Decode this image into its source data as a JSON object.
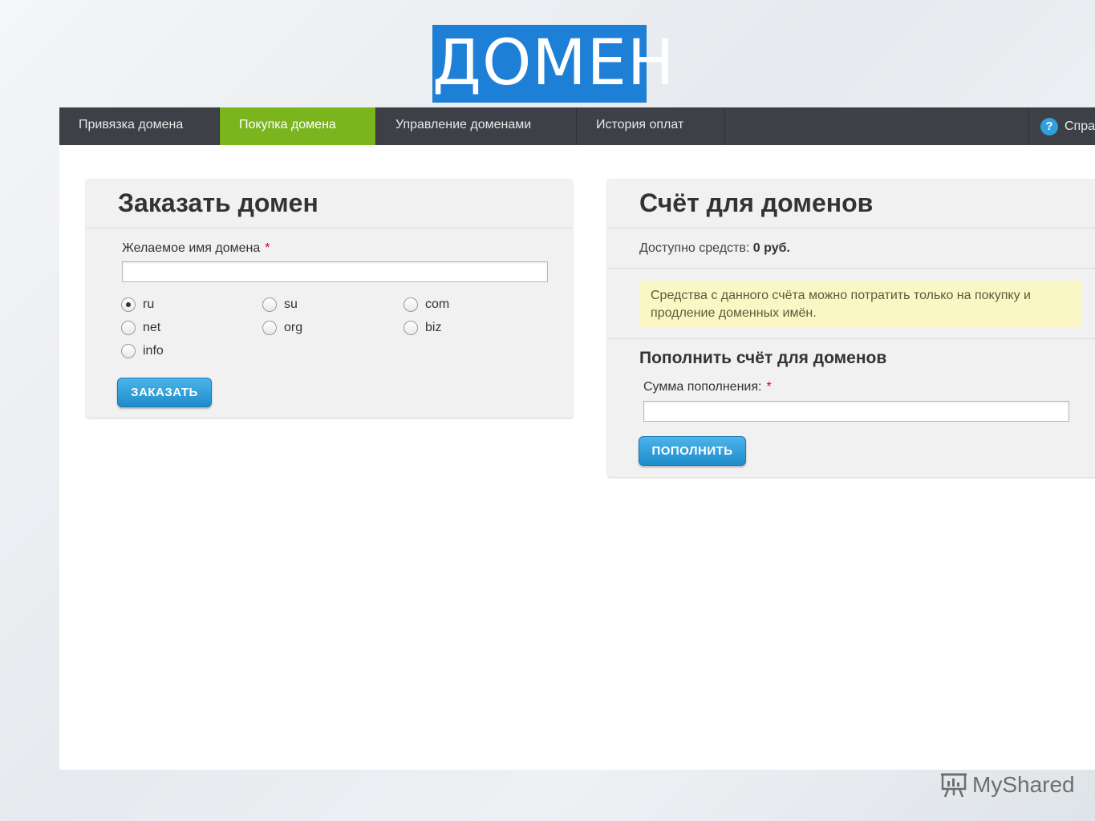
{
  "slide": {
    "title": "ДОМЕН"
  },
  "nav": {
    "tabs": [
      {
        "label": "Привязка домена"
      },
      {
        "label": "Покупка домена"
      },
      {
        "label": "Управление доменами"
      },
      {
        "label": "История оплат"
      }
    ],
    "help_label": "Спра",
    "help_icon": "question-icon",
    "active_color": "#7ab51d"
  },
  "order_panel": {
    "title": "Заказать домен",
    "domain_label": "Желаемое имя домена",
    "required_mark": "*",
    "domain_value": "",
    "zones": [
      "ru",
      "su",
      "com",
      "net",
      "org",
      "biz",
      "info"
    ],
    "selected_zone": "ru",
    "submit_label": "ЗАКАЗАТЬ"
  },
  "account_panel": {
    "title": "Счёт для доменов",
    "balance_label": "Доступно средств:",
    "balance_value": "0 руб.",
    "note": "Средства с данного счёта можно потратить только на покупку и продление доменных имён.",
    "topup_title": "Пополнить счёт для доменов",
    "amount_label": "Сумма пополнения:",
    "required_mark": "*",
    "amount_value": "",
    "submit_label": "ПОПОЛНИТЬ"
  },
  "footer": {
    "brand": "MyShared"
  }
}
